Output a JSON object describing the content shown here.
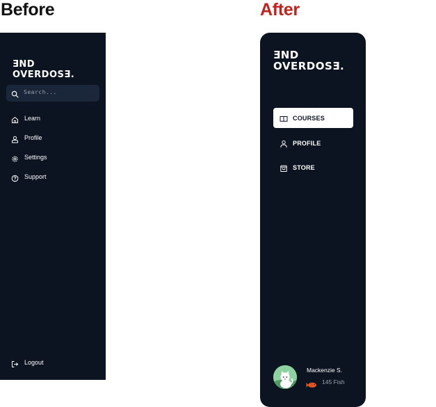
{
  "headings": {
    "before": "Before",
    "after": "After"
  },
  "colors": {
    "panel": "#0c1422",
    "after_heading": "#c0231d",
    "search_bg": "#1a2639",
    "fish": "#e8591f"
  },
  "before": {
    "logo": {
      "line1": "ƎND",
      "line2": "OVERDOSƎ."
    },
    "search": {
      "placeholder": "Search...",
      "icon": "search-icon"
    },
    "nav": [
      {
        "label": "Learn",
        "icon": "home-icon"
      },
      {
        "label": "Profile",
        "icon": "user-icon"
      },
      {
        "label": "Settings",
        "icon": "gear-icon"
      },
      {
        "label": "Support",
        "icon": "help-circle-icon"
      }
    ],
    "logout": {
      "label": "Logout",
      "icon": "logout-icon"
    }
  },
  "after": {
    "logo": {
      "line1": "ƎND",
      "line2": "OVERDOSƎ."
    },
    "nav": [
      {
        "label": "COURSES",
        "icon": "book-icon",
        "active": true
      },
      {
        "label": "PROFILE",
        "icon": "user-icon",
        "active": false
      },
      {
        "label": "STORE",
        "icon": "shopping-bag-icon",
        "active": false
      }
    ],
    "user": {
      "name": "Mackenzie S.",
      "currency": "145 Fish",
      "avatar": "cat-avatar",
      "currency_icon": "fish-icon"
    }
  }
}
